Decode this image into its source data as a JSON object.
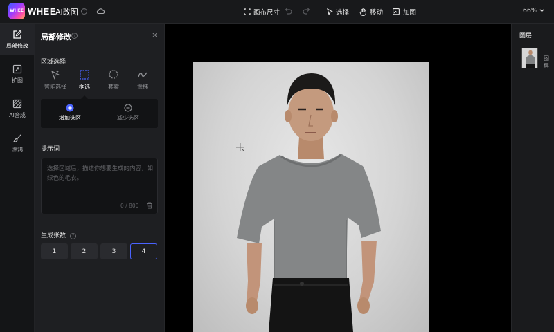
{
  "header": {
    "logo_text": "WHEE",
    "brand": "WHEE",
    "app_title": "AI改图",
    "help_glyph": "?",
    "toolbar": {
      "canvas_size": "画布尺寸",
      "select": "选择",
      "move": "移动",
      "add_image": "加图"
    },
    "zoom": "66%"
  },
  "left_rail": {
    "items": [
      {
        "label": "局部修改",
        "icon": "edit-icon",
        "active": true
      },
      {
        "label": "扩图",
        "icon": "expand-icon",
        "active": false
      },
      {
        "label": "AI合成",
        "icon": "compose-icon",
        "active": false
      },
      {
        "label": "涂鸦",
        "icon": "brush-icon",
        "active": false
      }
    ]
  },
  "panel": {
    "title": "局部修改",
    "help_glyph": "?",
    "close_glyph": "×",
    "region_label": "区域选择",
    "tools": [
      {
        "label": "智能选择",
        "icon": "smart-select-icon"
      },
      {
        "label": "框选",
        "icon": "box-select-icon"
      },
      {
        "label": "套索",
        "icon": "lasso-icon"
      },
      {
        "label": "涂抹",
        "icon": "smear-icon"
      }
    ],
    "active_tool": "框选",
    "modes": [
      {
        "label": "增加选区",
        "icon": "plus-circle-icon"
      },
      {
        "label": "减少选区",
        "icon": "minus-circle-icon"
      }
    ],
    "active_mode": "增加选区",
    "prompt_label": "提示词",
    "prompt_placeholder": "选择区域后，描述你想要生成的内容，如绿色的毛衣。",
    "prompt_count": "0 / 800",
    "count_label": "生成张数",
    "counts": [
      "1",
      "2",
      "3",
      "4"
    ],
    "selected_count": "4"
  },
  "right_panel": {
    "title": "图层",
    "layer_name": "图层"
  },
  "colors": {
    "accent": "#4a63ff",
    "panel_bg": "#1e1f22",
    "canvas_bg": "#000000"
  }
}
